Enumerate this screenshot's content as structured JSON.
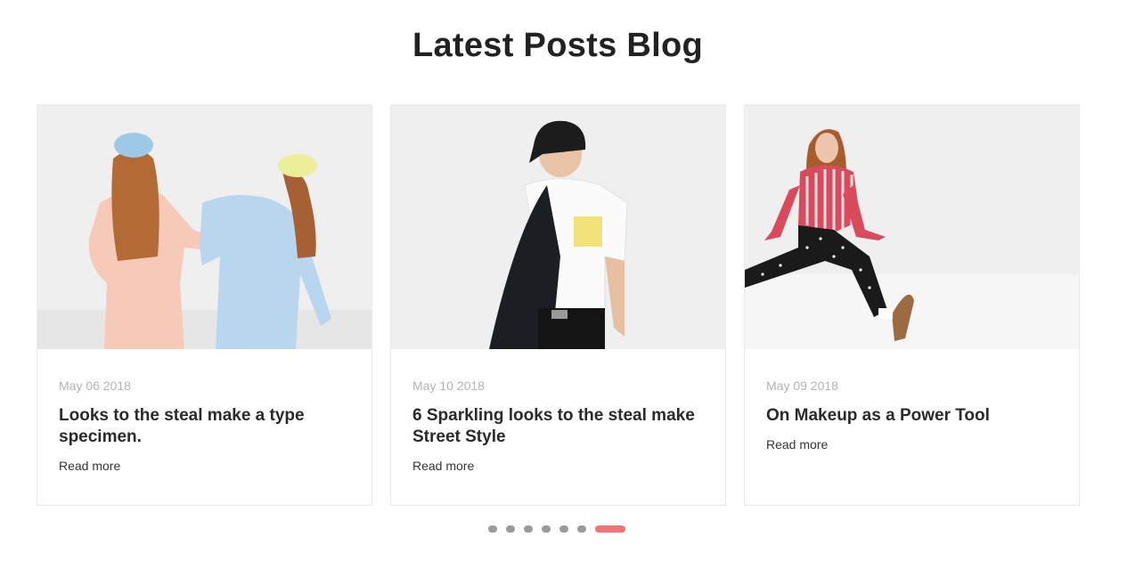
{
  "section": {
    "title": "Latest Posts Blog"
  },
  "posts": [
    {
      "date": "May 06 2018",
      "title": "Looks to the steal make a type specimen.",
      "read_more": "Read more",
      "image_icon": "two-women-pastel-suits-photo"
    },
    {
      "date": "May 10 2018",
      "title": "6 Sparkling looks to the steal make Street Style",
      "read_more": "Read more",
      "image_icon": "man-black-cap-white-tshirt-photo"
    },
    {
      "date": "May 09 2018",
      "title": "On Makeup as a Power Tool",
      "read_more": "Read more",
      "image_icon": "girl-striped-shirt-sitting-photo"
    }
  ],
  "pagination": {
    "count": 7,
    "active_index": 6
  },
  "colors": {
    "accent": "#f07474",
    "dot": "#9a9a9a",
    "date_text": "#b3b3b3",
    "border": "#ebebeb"
  }
}
